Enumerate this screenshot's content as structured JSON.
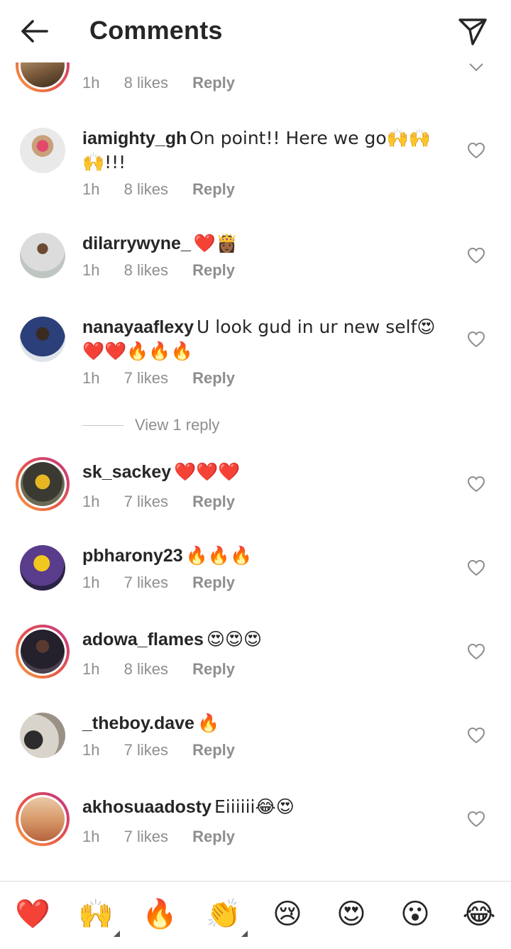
{
  "header": {
    "title": "Comments",
    "back_icon": "arrow-left-icon",
    "send_icon": "paper-plane-icon"
  },
  "colors": {
    "text": "#262626",
    "muted": "#8e8e8e",
    "divider": "#dbdbdb",
    "story_ring_start": "#f9a03f",
    "story_ring_end": "#c13584"
  },
  "partial_comment": {
    "time": "1h",
    "likes": "8 likes",
    "reply": "Reply"
  },
  "comments": [
    {
      "username": "iamighty_gh",
      "text": "On point!! Here we go🙌🙌🙌!!!",
      "time": "1h",
      "likes": "8 likes",
      "reply": "Reply"
    },
    {
      "username": "dilarrywyne_",
      "text": "❤️👸🏾",
      "time": "1h",
      "likes": "8 likes",
      "reply": "Reply"
    },
    {
      "username": "nanayaaflexy",
      "text": "U look gud in ur new self😍❤️❤️🔥🔥🔥",
      "time": "1h",
      "likes": "7 likes",
      "reply": "Reply",
      "view_replies": "View 1 reply"
    },
    {
      "username": "sk_sackey",
      "text": "❤️❤️❤️",
      "time": "1h",
      "likes": "7 likes",
      "reply": "Reply"
    },
    {
      "username": "pbharony23",
      "text": "🔥🔥🔥",
      "time": "1h",
      "likes": "7 likes",
      "reply": "Reply"
    },
    {
      "username": "adowa_flames",
      "text": "😍😍😍",
      "time": "1h",
      "likes": "8 likes",
      "reply": "Reply"
    },
    {
      "username": "_theboy.dave",
      "text": "🔥",
      "time": "1h",
      "likes": "7 likes",
      "reply": "Reply"
    },
    {
      "username": "akhosuaadosty",
      "text": "Eiiiiii😂😍",
      "time": "1h",
      "likes": "7 likes",
      "reply": "Reply"
    }
  ],
  "emoji_bar": [
    "❤️",
    "🙌",
    "🔥",
    "👏",
    "😢",
    "😍",
    "😮",
    "😂"
  ]
}
